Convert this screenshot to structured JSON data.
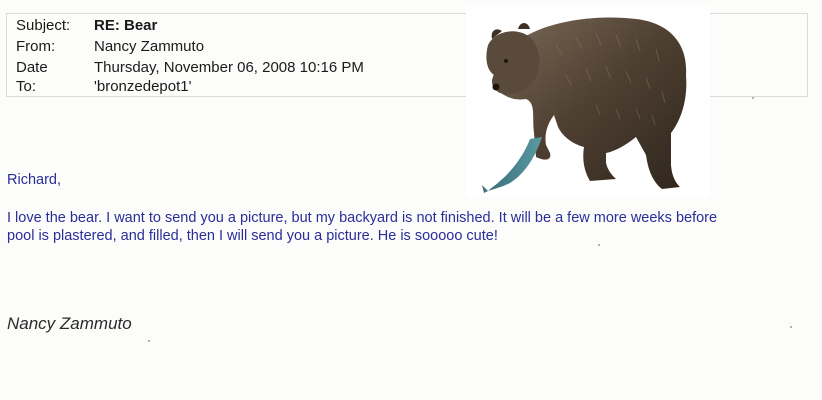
{
  "email": {
    "headers": [
      {
        "label": "Subject:",
        "value": "RE: Bear",
        "bold": true
      },
      {
        "label": "From:",
        "value": "Nancy Zammuto"
      },
      {
        "label": "Date",
        "value": "Thursday, November 06, 2008 10:16 PM"
      },
      {
        "label": "To:",
        "value": "'bronzedepot1'"
      }
    ],
    "greeting": "Richard,",
    "body_line_1": "I love the bear.  I want to send you a picture, but my backyard is not finished.  It will be a few more weeks before",
    "body_line_2": "pool is plastered, and filled, then I will send you a picture.  He is sooooo cute!",
    "signature": "Nancy Zammuto"
  },
  "photo": {
    "subject": "bronze bear sculpture holding a fish",
    "colors": {
      "bronze": "#5b4a3a",
      "fish_patina": "#3f7e86"
    }
  }
}
